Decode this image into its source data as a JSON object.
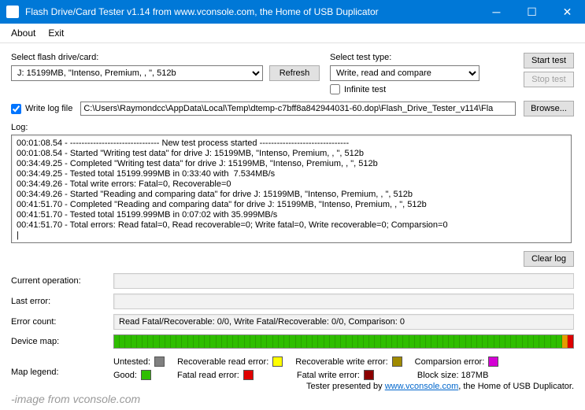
{
  "window": {
    "title": "Flash Drive/Card Tester v1.14 from www.vconsole.com, the Home of USB Duplicator"
  },
  "menu": {
    "about": "About",
    "exit": "Exit"
  },
  "labels": {
    "select_drive": "Select flash drive/card:",
    "select_test": "Select test type:",
    "infinite": "Infinite test",
    "write_log": "Write log file",
    "log": "Log:",
    "current_op": "Current operation:",
    "last_error": "Last error:",
    "error_count": "Error count:",
    "device_map": "Device map:",
    "map_legend": "Map legend:"
  },
  "buttons": {
    "refresh": "Refresh",
    "start": "Start test",
    "stop": "Stop test",
    "browse": "Browse...",
    "clear": "Clear log"
  },
  "drive_select": "J: 15199MB, \"Intenso, Premium, , \", 512b",
  "test_select": "Write, read and compare",
  "log_path": "C:\\Users\\Raymondcc\\AppData\\Local\\Temp\\dtemp-c7bff8a842944031-60.dop\\Flash_Drive_Tester_v114\\Fla",
  "log_lines": [
    "00:01:08.54 - ------------------------------- New test process started -------------------------------",
    "00:01:08.54 - Started \"Writing test data\" for drive J: 15199MB, \"Intenso, Premium, , \", 512b",
    "00:34:49.25 - Completed \"Writing test data\" for drive J: 15199MB, \"Intenso, Premium, , \", 512b",
    "00:34:49.25 - Tested total 15199.999MB in 0:33:40 with  7.534MB/s",
    "00:34:49.26 - Total write errors: Fatal=0, Recoverable=0",
    "00:34:49.26 - Started \"Reading and comparing data\" for drive J: 15199MB, \"Intenso, Premium, , \", 512b",
    "00:41:51.70 - Completed \"Reading and comparing data\" for drive J: 15199MB, \"Intenso, Premium, , \", 512b",
    "00:41:51.70 - Tested total 15199.999MB in 0:07:02 with 35.999MB/s",
    "00:41:51.70 - Total errors: Read fatal=0, Read recoverable=0; Write fatal=0, Write recoverable=0; Comparsion=0"
  ],
  "error_count_text": "Read Fatal/Recoverable: 0/0, Write Fatal/Recoverable: 0/0, Comparison: 0",
  "legend": {
    "untested": "Untested:",
    "good": "Good:",
    "rec_read": "Recoverable read error:",
    "fatal_read": "Fatal read error:",
    "rec_write": "Recoverable write error:",
    "fatal_write": "Fatal write error:",
    "comparison": "Comparsion error:",
    "block_size": "Block size: 187MB"
  },
  "footer": {
    "prefix": "Tester presented by ",
    "link": "www.vconsole.com",
    "suffix": ", the Home of USB Duplicator."
  },
  "watermark": "-image from vconsole.com"
}
